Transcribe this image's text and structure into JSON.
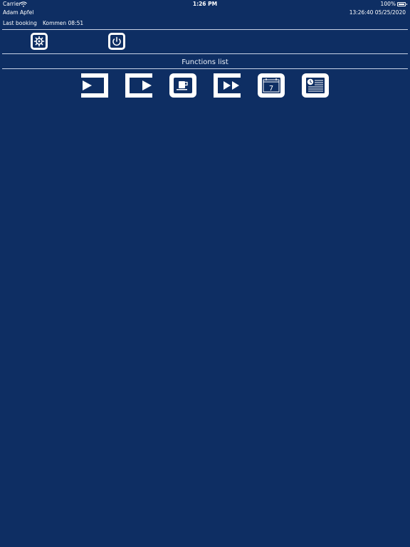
{
  "status_bar": {
    "carrier": "Carrier",
    "time": "1:26 PM",
    "battery": "100%"
  },
  "user": {
    "name": "Adam Apfel",
    "datetime": "13:26:40 05/25/2020"
  },
  "booking": {
    "label": "Last booking",
    "value": "Kommen 08:51"
  },
  "toolbar": {
    "buttons": [
      {
        "icon": "gear-icon"
      },
      {
        "icon": "power-icon"
      }
    ]
  },
  "functions": {
    "title": "Functions list",
    "items": [
      {
        "icon": "come-icon"
      },
      {
        "icon": "go-icon"
      },
      {
        "icon": "coffee-break-icon"
      },
      {
        "icon": "fast-forward-icon"
      },
      {
        "icon": "calendar-icon",
        "day": "7"
      },
      {
        "icon": "timesheet-icon"
      }
    ]
  },
  "colors": {
    "background": "#0e2e63",
    "foreground": "#ffffff"
  }
}
